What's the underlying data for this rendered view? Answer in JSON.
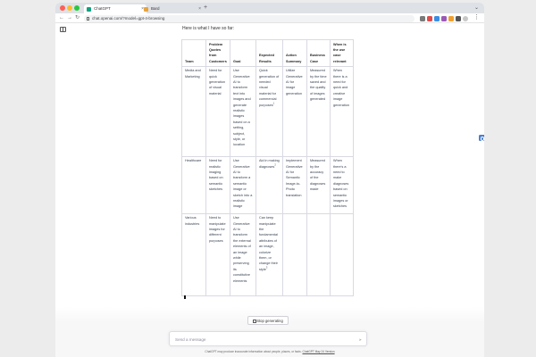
{
  "browser": {
    "tabs": [
      {
        "title": "ChatGPT",
        "active": true
      },
      {
        "title": "Bard",
        "active": false
      }
    ],
    "new_tab_symbol": "+",
    "url": "chat.openai.com/?model=gpt-4-browsing",
    "nav": {
      "back": "←",
      "forward": "→",
      "reload": "↻"
    },
    "menu_symbol": "⋮",
    "tab_close_symbol": "×"
  },
  "chat": {
    "intro": "Here is what I have so far:",
    "table": {
      "headers": [
        "Team",
        "Problem Quotes from Customers",
        "Goal",
        "Expected Results",
        "Action Summary",
        "Business Case",
        "When is the use case relevant"
      ],
      "rows": [
        [
          "Media and Marketing",
          "Need for quick generation of visual material",
          "Use Generative AI to transform text into images and generate realistic images based on a setting, subject, style, or location",
          "Quick generation of needed visual material for commercial purposes",
          "Utilize Generative AI for image generation",
          "Measured by the time saved and the quality of images generated",
          "When there is a need for quick and creative image generation"
        ],
        [
          "Healthcare",
          "Need for realistic imaging based on semantic sketches",
          "Use Generative AI to transform a semantic image or sketch into a realistic image",
          "Aid in making diagnoses",
          "Implement Generative AI for Semantic Image-to-Photo translation",
          "Measured by the accuracy of the diagnoses made",
          "When there's a need to make diagnoses based on semantic images or sketches"
        ],
        [
          "Various industries",
          "Need to manipulate images for different purposes",
          "Use Generative AI to transform the external elements of an image while preserving its constitutive elements",
          "Can keep manipulate the fundamental attributes of an image, colorize them, or change their style",
          "",
          "",
          ""
        ]
      ],
      "footnotes": [
        [
          null,
          null,
          null,
          "1",
          null,
          null,
          null
        ],
        [
          null,
          null,
          null,
          "2",
          null,
          null,
          null
        ],
        [
          null,
          null,
          null,
          "3",
          null,
          null,
          null
        ]
      ]
    },
    "stop_button": "Stop generating",
    "composer_placeholder": "Send a message",
    "footer_text": "ChatGPT may produce inaccurate information about people, places, or facts.",
    "footer_link": "ChatGPT May 24 Version"
  },
  "colors": {
    "accent_widget": "#4a7fd0",
    "tab_icon_chatgpt": "#10a37f",
    "tab_icon_bard": "#e8a33d"
  }
}
